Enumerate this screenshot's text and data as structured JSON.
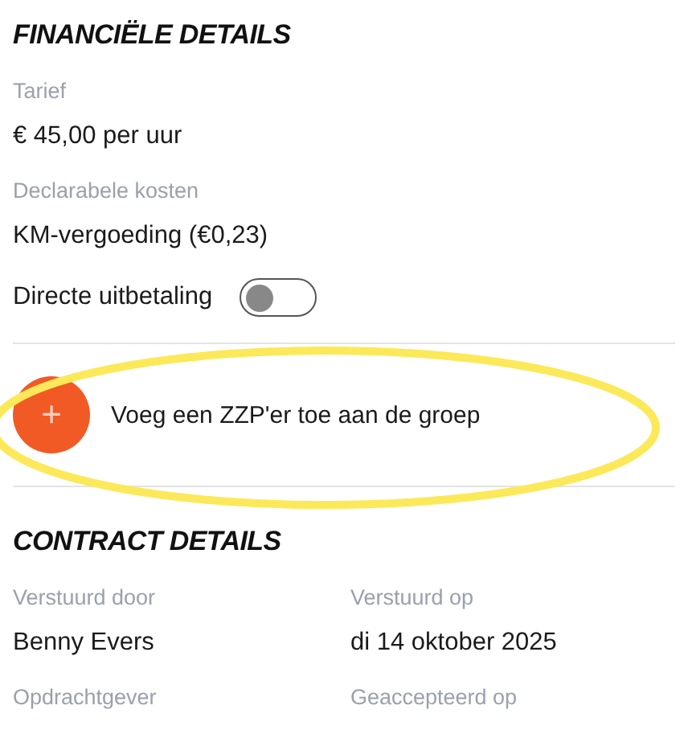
{
  "financial": {
    "title": "FINANCIËLE DETAILS",
    "fields": [
      {
        "label": "Tarief",
        "value": "€ 45,00 per uur"
      },
      {
        "label": "Declarabele kosten",
        "value": "KM-vergoeding (€0,23)"
      }
    ],
    "toggle": {
      "label": "Directe uitbetaling",
      "on": false
    }
  },
  "add_action": {
    "icon": "+",
    "label": "Voeg een ZZP'er toe aan de groep",
    "highlighted": true
  },
  "contract": {
    "title": "CONTRACT DETAILS",
    "fields": [
      {
        "label": "Verstuurd door",
        "value": "Benny Evers"
      },
      {
        "label": "Verstuurd op",
        "value": "di 14 oktober 2025"
      },
      {
        "label": "Opdrachtgever"
      },
      {
        "label": "Geaccepteerd op"
      }
    ]
  }
}
